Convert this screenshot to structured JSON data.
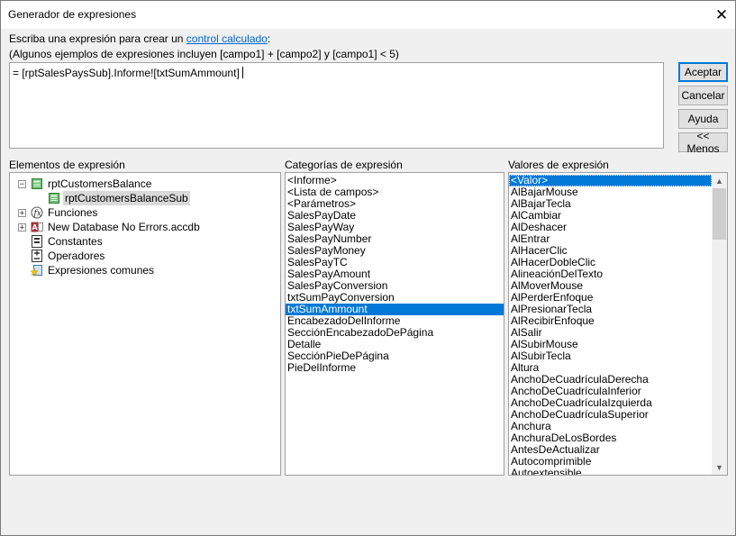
{
  "window": {
    "title": "Generador de expresiones"
  },
  "instructions": {
    "line1_prefix": "Escriba una expresión para crear un ",
    "line1_link": "control calculado",
    "line1_suffix": ":",
    "line2": "(Algunos ejemplos de expresiones incluyen [campo1] + [campo2] y [campo1] < 5)"
  },
  "expression": {
    "value": "= [rptSalesPaysSub].Informe![txtSumAmmount]"
  },
  "buttons": {
    "accept": "Aceptar",
    "cancel": "Cancelar",
    "help": "Ayuda",
    "less": "<< Menos"
  },
  "elements": {
    "label": "Elementos de expresión",
    "items": [
      {
        "label": "rptCustomersBalance",
        "icon": "report-icon",
        "expander": "minus"
      },
      {
        "label": "rptCustomersBalanceSub",
        "icon": "report-icon",
        "expander": "none",
        "selected": true
      },
      {
        "label": "Funciones",
        "icon": "function-icon",
        "expander": "plus"
      },
      {
        "label": "New Database No Errors.accdb",
        "icon": "database-icon",
        "expander": "plus"
      },
      {
        "label": "Constantes",
        "icon": "constants-icon",
        "expander": "none"
      },
      {
        "label": "Operadores",
        "icon": "operators-icon",
        "expander": "none"
      },
      {
        "label": "Expresiones comunes",
        "icon": "common-expressions-icon",
        "expander": "none"
      }
    ]
  },
  "categories": {
    "label": "Categorías de expresión",
    "selected": "txtSumAmmount",
    "items": [
      "<Informe>",
      "<Lista de campos>",
      "<Parámetros>",
      "SalesPayDate",
      "SalesPayWay",
      "SalesPayNumber",
      "SalesPayMoney",
      "SalesPayTC",
      "SalesPayAmount",
      "SalesPayConversion",
      "txtSumPayConversion",
      "txtSumAmmount",
      "EncabezadoDelInforme",
      "SecciónEncabezadoDePágina",
      "Detalle",
      "SecciónPieDePágina",
      "PieDelInforme"
    ]
  },
  "values": {
    "label": "Valores de expresión",
    "selected": "<Valor>",
    "items": [
      "<Valor>",
      "AlBajarMouse",
      "AlBajarTecla",
      "AlCambiar",
      "AlDeshacer",
      "AlEntrar",
      "AlHacerClic",
      "AlHacerDobleClic",
      "AlineaciónDelTexto",
      "AlMoverMouse",
      "AlPerderEnfoque",
      "AlPresionarTecla",
      "AlRecibirEnfoque",
      "AlSalir",
      "AlSubirMouse",
      "AlSubirTecla",
      "Altura",
      "AnchoDeCuadrículaDerecha",
      "AnchoDeCuadrículaInferior",
      "AnchoDeCuadrículaIzquierda",
      "AnchoDeCuadrículaSuperior",
      "Anchura",
      "AnchuraDeLosBordes",
      "AntesDeActualizar",
      "Autocomprimible",
      "Autoextensible"
    ]
  }
}
